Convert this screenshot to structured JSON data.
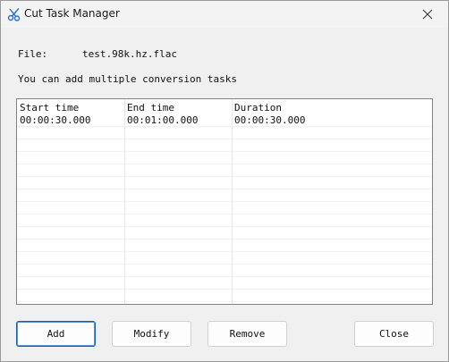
{
  "window": {
    "title": "Cut Task Manager",
    "icon": "scissors-icon"
  },
  "file": {
    "label": "File:",
    "name": "test.98k.hz.flac"
  },
  "hint": "You can add multiple conversion tasks",
  "table": {
    "columns": [
      "Start time",
      "End time",
      "Duration"
    ],
    "rows": [
      [
        "00:00:30.000",
        "00:01:00.000",
        "00:00:30.000"
      ]
    ]
  },
  "buttons": {
    "add": "Add",
    "modify": "Modify",
    "remove": "Remove",
    "close": "Close"
  },
  "colors": {
    "accent": "#1a5fb4",
    "icon_blue": "#2a6fc9"
  }
}
